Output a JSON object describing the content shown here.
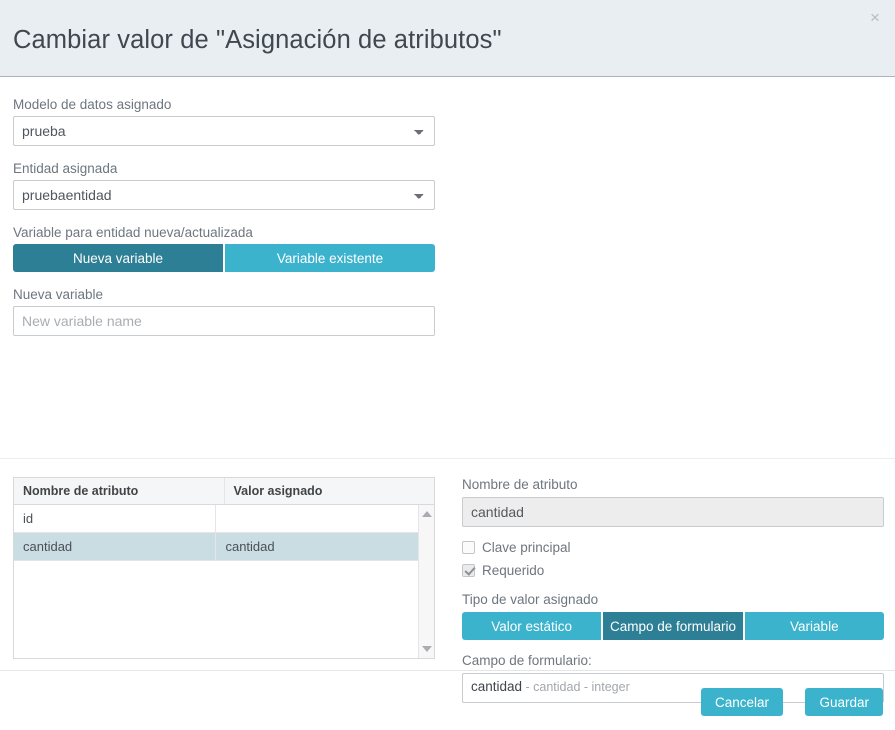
{
  "header": {
    "title": "Cambiar valor de \"Asignación de atributos\"",
    "close_icon": "close-icon",
    "close_label": "×"
  },
  "form": {
    "data_model": {
      "label": "Modelo de datos asignado",
      "value": "prueba",
      "options": [
        "prueba"
      ]
    },
    "entity": {
      "label": "Entidad asignada",
      "value": "pruebaentidad",
      "options": [
        "pruebaentidad"
      ]
    },
    "variable_mode": {
      "label": "Variable para entidad nueva/actualizada",
      "options": [
        "Nueva variable",
        "Variable existente"
      ],
      "selected": "Nueva variable"
    },
    "new_variable": {
      "label": "Nueva variable",
      "value": "",
      "placeholder": "New variable name"
    }
  },
  "attributes_table": {
    "columns": [
      "Nombre de atributo",
      "Valor asignado"
    ],
    "rows": [
      {
        "name": "id",
        "value": "",
        "selected": false
      },
      {
        "name": "cantidad",
        "value": "cantidad",
        "selected": true
      }
    ],
    "scrollbar": {
      "up_icon": "scroll-up-arrow-icon",
      "down_icon": "scroll-down-arrow-icon"
    }
  },
  "detail": {
    "attribute_name": {
      "label": "Nombre de atributo",
      "value": "cantidad"
    },
    "primary_key": {
      "label": "Clave principal",
      "checked": false
    },
    "required": {
      "label": "Requerido",
      "checked": true
    },
    "value_type": {
      "label": "Tipo de valor asignado",
      "options": [
        "Valor estático",
        "Campo de formulario",
        "Variable"
      ],
      "selected": "Campo de formulario"
    },
    "form_field": {
      "label": "Campo de formulario:",
      "value": "cantidad",
      "meta": " - cantidad - integer"
    }
  },
  "footer": {
    "cancel_label": "Cancelar",
    "save_label": "Guardar"
  },
  "colors": {
    "accent_active": "#2d7f96",
    "accent": "#3bb3cd",
    "header_bg": "#e9eef2",
    "row_selected": "#c9dde2"
  }
}
